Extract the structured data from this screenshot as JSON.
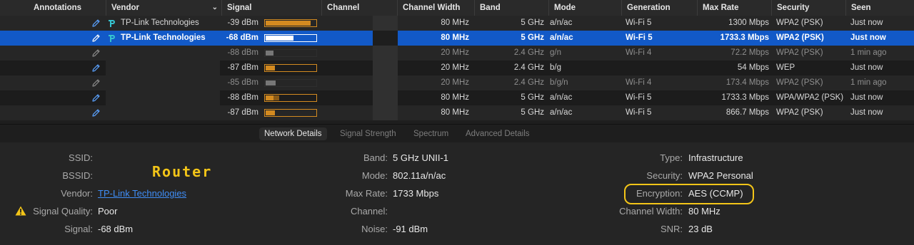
{
  "table": {
    "headers": {
      "annotations": "Annotations",
      "vendor": "Vendor",
      "signal": "Signal",
      "channel": "Channel",
      "channel_width": "Channel Width",
      "band": "Band",
      "mode": "Mode",
      "generation": "Generation",
      "max_rate": "Max Rate",
      "security": "Security",
      "seen": "Seen"
    },
    "rows": [
      {
        "vendor": "TP-Link Technologies",
        "signal": "-39 dBm",
        "signal_level": 0.9,
        "channel_width": "80 MHz",
        "band": "5 GHz",
        "mode": "a/n/ac",
        "generation": "Wi-Fi 5",
        "max_rate": "1300 Mbps",
        "security": "WPA2 (PSK)",
        "seen": "Just now"
      },
      {
        "vendor": "TP-Link Technologies",
        "signal": "-68 dBm",
        "signal_level": 0.55,
        "channel_width": "80 MHz",
        "band": "5 GHz",
        "mode": "a/n/ac",
        "generation": "Wi-Fi 5",
        "max_rate": "1733.3 Mbps",
        "security": "WPA2 (PSK)",
        "seen": "Just now"
      },
      {
        "vendor": "",
        "signal": "-88 dBm",
        "signal_level": 0.15,
        "channel_width": "20 MHz",
        "band": "2.4 GHz",
        "mode": "g/n",
        "generation": "Wi-Fi 4",
        "max_rate": "72.2 Mbps",
        "security": "WPA2 (PSK)",
        "seen": "1 min ago"
      },
      {
        "vendor": "",
        "signal": "-87 dBm",
        "signal_level": 0.18,
        "channel_width": "20 MHz",
        "band": "2.4 GHz",
        "mode": "b/g",
        "generation": "",
        "max_rate": "54 Mbps",
        "security": "WEP",
        "seen": "Just now"
      },
      {
        "vendor": "",
        "signal": "-85 dBm",
        "signal_level": 0.2,
        "channel_width": "20 MHz",
        "band": "2.4 GHz",
        "mode": "b/g/n",
        "generation": "Wi-Fi 4",
        "max_rate": "173.4 Mbps",
        "security": "WPA2 (PSK)",
        "seen": "1 min ago"
      },
      {
        "vendor": "",
        "signal": "-88 dBm",
        "signal_level": 0.15,
        "channel_width": "80 MHz",
        "band": "5 GHz",
        "mode": "a/n/ac",
        "generation": "Wi-Fi 5",
        "max_rate": "1733.3 Mbps",
        "security": "WPA/WPA2 (PSK)",
        "seen": "Just now"
      },
      {
        "vendor": "",
        "signal": "-87 dBm",
        "signal_level": 0.18,
        "channel_width": "80 MHz",
        "band": "5 GHz",
        "mode": "a/n/ac",
        "generation": "Wi-Fi 5",
        "max_rate": "866.7 Mbps",
        "security": "WPA2 (PSK)",
        "seen": "Just now"
      }
    ]
  },
  "tabs": [
    "Network Details",
    "Signal Strength",
    "Spectrum",
    "Advanced Details"
  ],
  "details": {
    "ssid_label": "SSID:",
    "ssid": "",
    "bssid_label": "BSSID:",
    "bssid": "",
    "vendor_label": "Vendor:",
    "vendor": "TP-Link Technologies",
    "quality_label": "Signal Quality:",
    "quality": "Poor",
    "signal_label": "Signal:",
    "signal": "-68 dBm",
    "band_label": "Band:",
    "band": "5 GHz UNII-1",
    "mode_label": "Mode:",
    "mode": "802.11a/n/ac",
    "maxrate_label": "Max Rate:",
    "maxrate": "1733 Mbps",
    "channel_label": "Channel:",
    "channel": "",
    "noise_label": "Noise:",
    "noise": "-91 dBm",
    "type_label": "Type:",
    "type": "Infrastructure",
    "security_label": "Security:",
    "security": "WPA2 Personal",
    "encryption_label": "Encryption:",
    "encryption": "AES (CCMP)",
    "chwidth_label": "Channel Width:",
    "chwidth": "80 MHz",
    "snr_label": "SNR:",
    "snr": "23 dB"
  },
  "annotation_text": "Router",
  "colors": {
    "accent": "#1259c7",
    "signal_bar": "#d38a20",
    "highlight": "#f3c518",
    "link": "#3f8df6"
  }
}
